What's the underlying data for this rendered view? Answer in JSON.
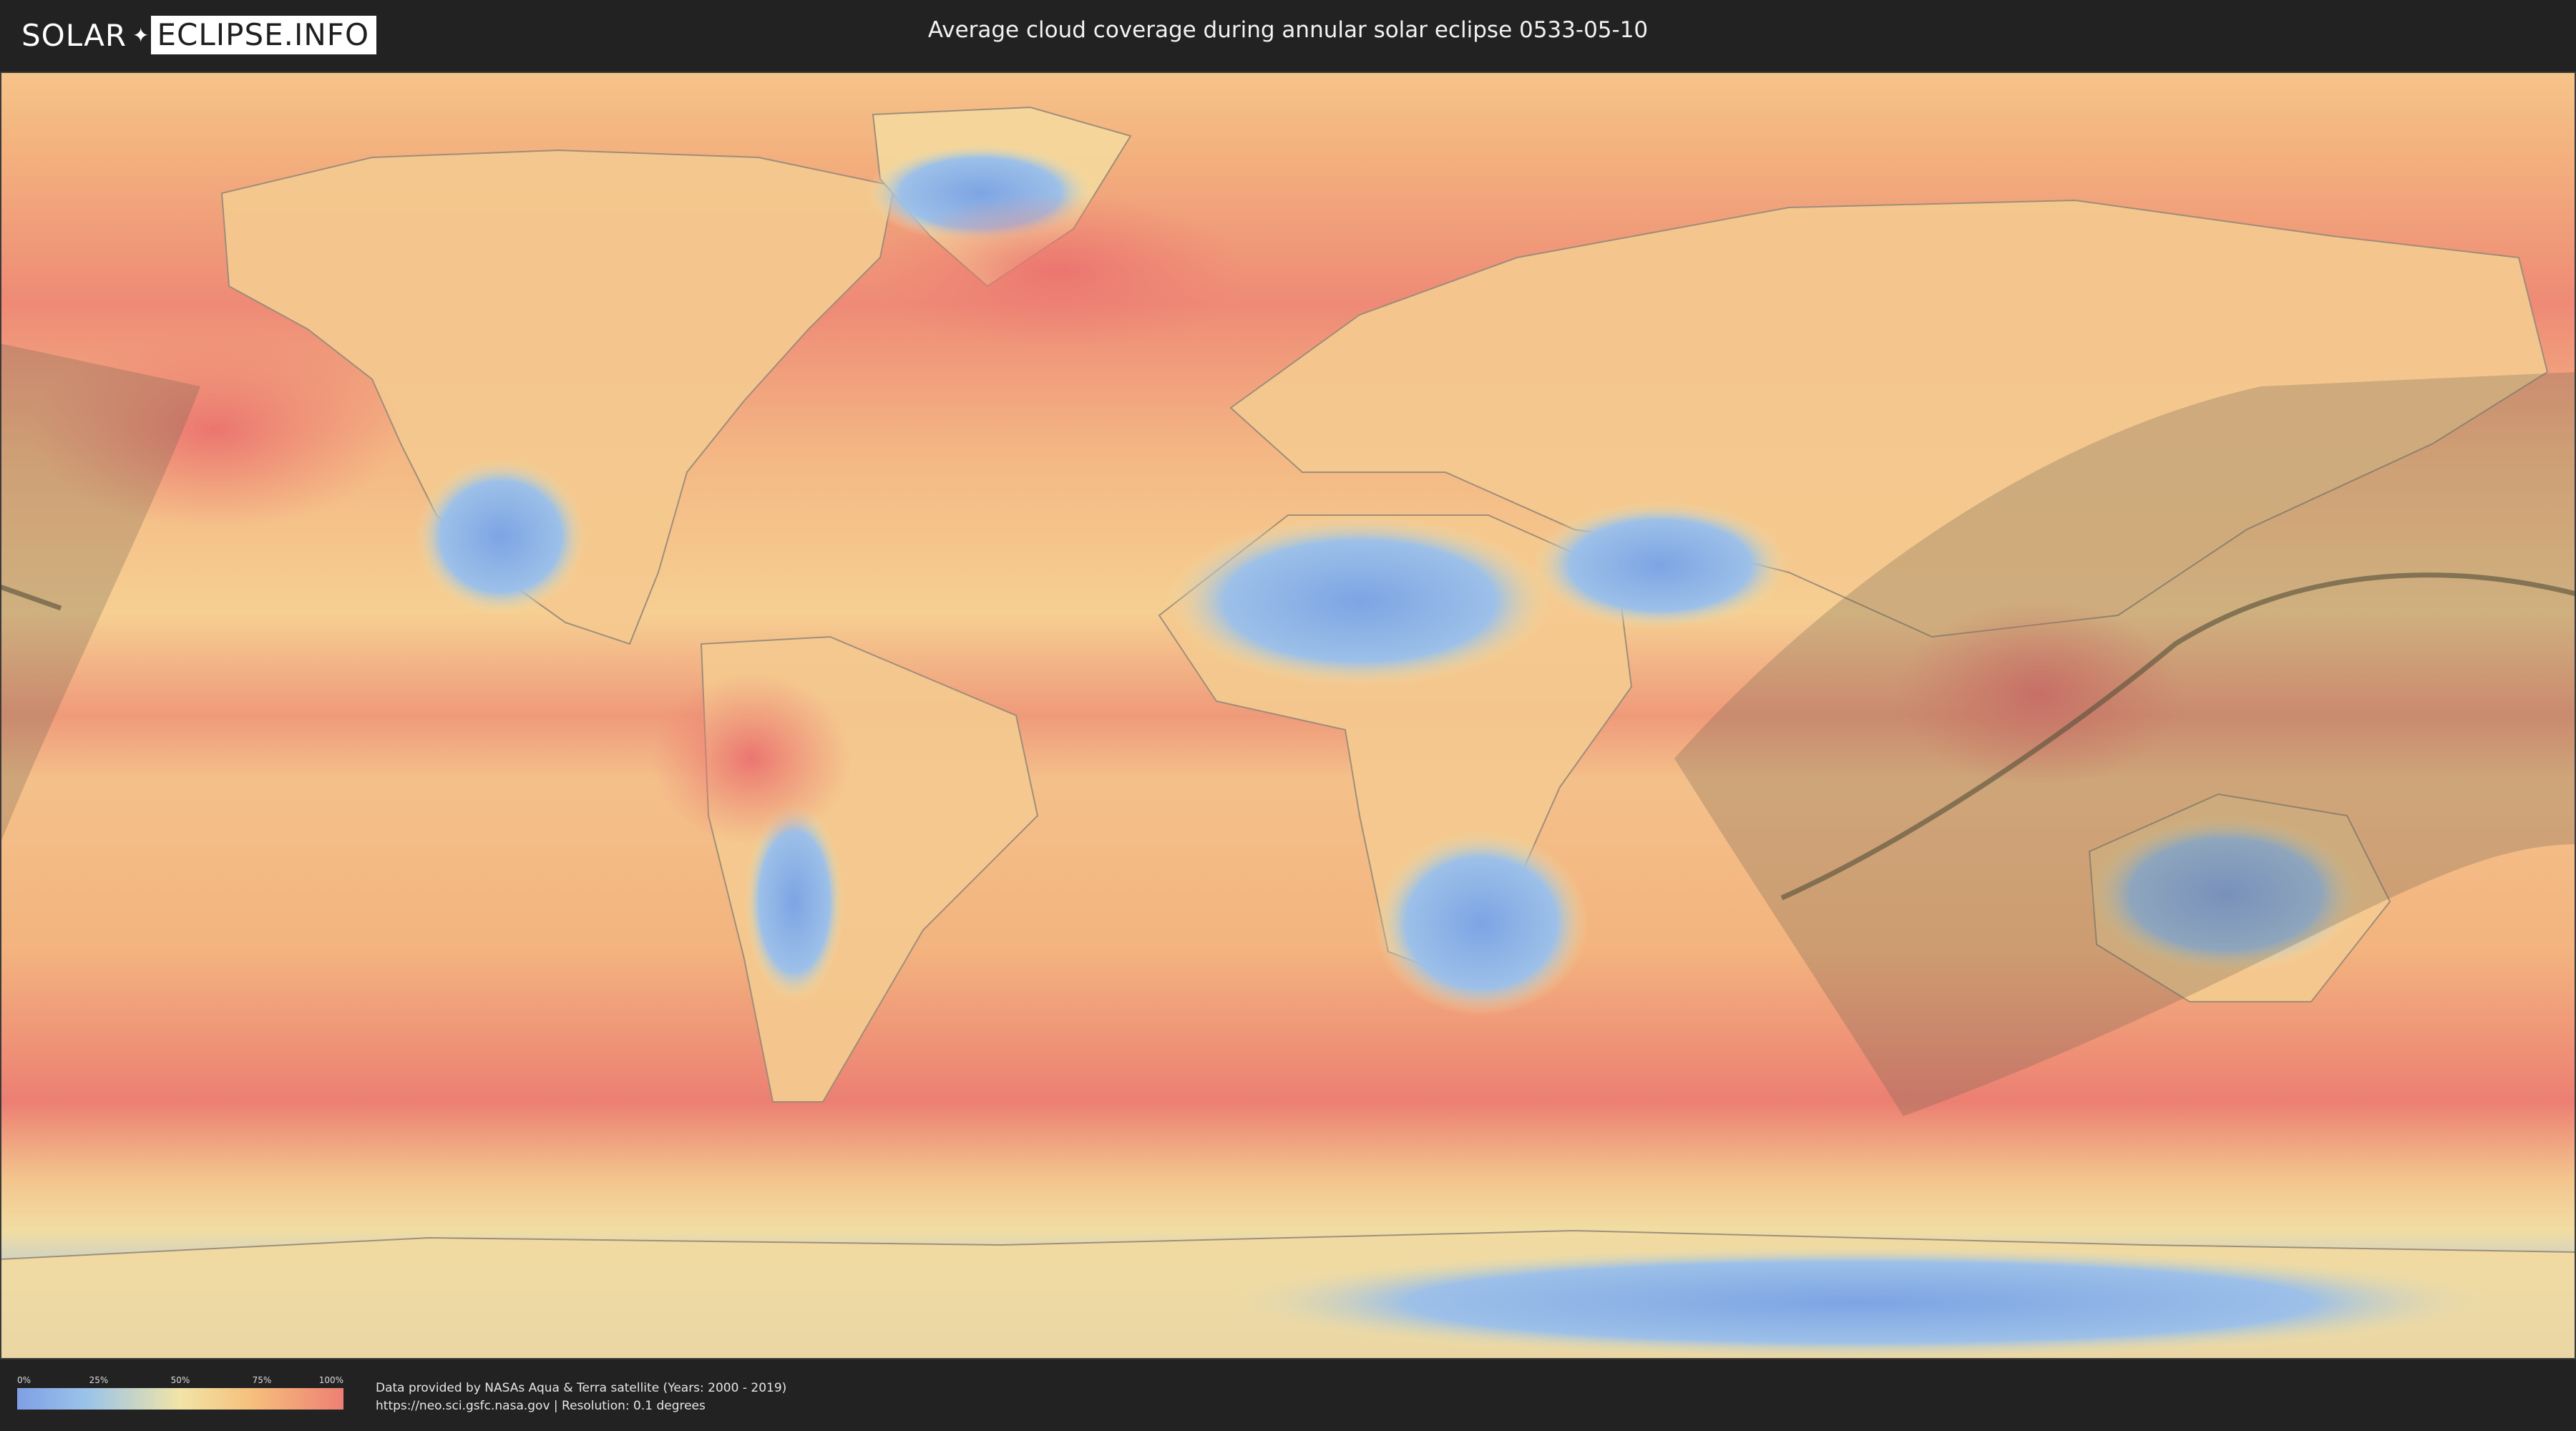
{
  "header": {
    "logo_left": "SOLAR",
    "logo_right": "ECLIPSE.INFO",
    "title": "Average cloud coverage during annular solar eclipse 0533-05-10"
  },
  "map": {
    "description_colors": {
      "clear": "#7fa0e6",
      "low": "#9cc4e8",
      "mid": "#f1e4a6",
      "high": "#f6bf7c",
      "overcast": "#ee7f73",
      "eclipse_shadow": "#6b6150",
      "path": "#5c553d",
      "border": "#8a7d6e"
    }
  },
  "legend": {
    "ticks": [
      "0%",
      "25%",
      "50%",
      "75%",
      "100%"
    ]
  },
  "footer": {
    "credit_line1": "Data provided by NASAs Aqua & Terra satellite (Years: 2000 - 2019)",
    "credit_line2": "https://neo.sci.gsfc.nasa.gov | Resolution: 0.1 degrees"
  }
}
